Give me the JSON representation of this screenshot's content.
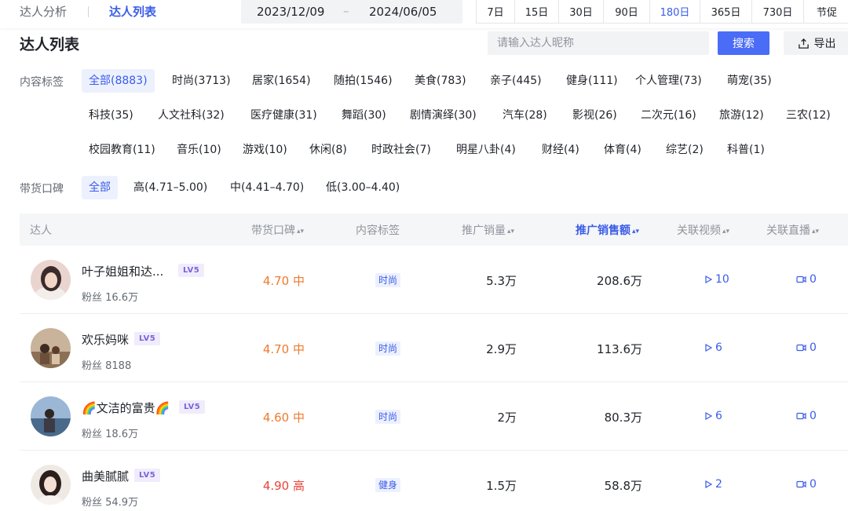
{
  "topbar": {
    "tab_analysis": "达人分析",
    "tab_list": "达人列表",
    "date_start": "2023/12/09",
    "date_separator": "–",
    "date_end": "2024/06/05",
    "periods": [
      {
        "label": "7日",
        "active": false
      },
      {
        "label": "15日",
        "active": false
      },
      {
        "label": "30日",
        "active": false
      },
      {
        "label": "90日",
        "active": false
      },
      {
        "label": "180日",
        "active": true
      },
      {
        "label": "365日",
        "active": false
      },
      {
        "label": "730日",
        "active": false
      },
      {
        "label": "节促",
        "active": false
      }
    ]
  },
  "header": {
    "title": "达人列表",
    "search_placeholder": "请输入达人昵称",
    "search_label": "搜索",
    "export_label": "导出"
  },
  "filters": {
    "content_label": "内容标签",
    "content_tags": [
      [
        "全部(8883)",
        "时尚(3713)",
        "居家(1654)",
        "随拍(1546)",
        "美食(783)",
        "亲子(445)",
        "健身(111)",
        "个人管理(73)",
        "萌宠(35)"
      ],
      [
        "科技(35)",
        "人文社科(32)",
        "医疗健康(31)",
        "舞蹈(30)",
        "剧情演绎(30)",
        "汽车(28)",
        "影视(26)",
        "二次元(16)",
        "旅游(12)",
        "三农(12)"
      ],
      [
        "校园教育(11)",
        "音乐(10)",
        "游戏(10)",
        "休闲(8)",
        "时政社会(7)",
        "明星八卦(4)",
        "财经(4)",
        "体育(4)",
        "综艺(2)",
        "科普(1)"
      ]
    ],
    "content_active": "全部(8883)",
    "reputation_label": "带货口碑",
    "reputation_options": [
      "全部",
      "高(4.71–5.00)",
      "中(4.41–4.70)",
      "低(3.00–4.40)"
    ],
    "reputation_active": "全部"
  },
  "table": {
    "columns": {
      "influencer": "达人",
      "reputation": "带货口碑",
      "content_tag": "内容标签",
      "sales_volume": "推广销量",
      "sales_amount": "推广销售额",
      "videos": "关联视频",
      "lives": "关联直播"
    },
    "sorted_column": "sales_amount",
    "rows": [
      {
        "name": "叶子姐姐和达...",
        "level": "LV5",
        "fans": "粉丝 16.6万",
        "score": "4.70 中",
        "tag": "时尚",
        "sales": "5.3万",
        "amount": "208.6万",
        "videos": "10",
        "lives": "0"
      },
      {
        "name": "欢乐妈咪",
        "level": "LV5",
        "fans": "粉丝 8188",
        "score": "4.70 中",
        "tag": "时尚",
        "sales": "2.9万",
        "amount": "113.6万",
        "videos": "6",
        "lives": "0"
      },
      {
        "name": "🌈文洁的富贵🌈",
        "level": "LV5",
        "fans": "粉丝 18.6万",
        "score": "4.60 中",
        "tag": "时尚",
        "sales": "2万",
        "amount": "80.3万",
        "videos": "6",
        "lives": "0"
      },
      {
        "name": "曲美腻腻",
        "level": "LV5",
        "fans": "粉丝 54.9万",
        "score": "4.90 高",
        "tag": "健身",
        "sales": "1.5万",
        "amount": "58.8万",
        "videos": "2",
        "lives": "0"
      }
    ]
  },
  "colors": {
    "accent": "#4a6cf7",
    "accent_text": "#3a5ce8",
    "medium_score": "#f07a2e",
    "high_score": "#e8443a",
    "level_badge": "#7b63d9"
  },
  "icons": {
    "export": "export-icon",
    "video": "play-icon",
    "live": "camera-icon",
    "sort": "sort-icon"
  }
}
